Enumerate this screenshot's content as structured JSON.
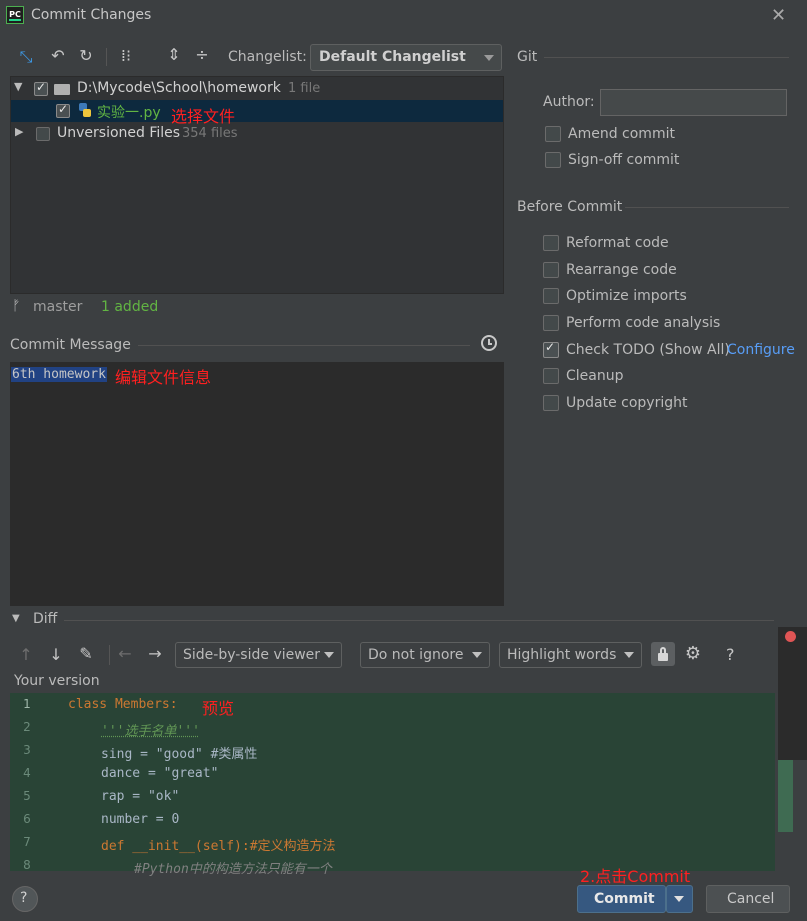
{
  "window": {
    "title": "Commit Changes",
    "close_icon": "close-icon"
  },
  "toolbar": {
    "icons": [
      "move-to-changelist-icon",
      "rollback-icon",
      "refresh-icon",
      "group-by-icon",
      "expand-all-icon",
      "collapse-all-icon"
    ],
    "changelist_label": "Changelist:",
    "changelist_value": "Default Changelist"
  },
  "tree": {
    "root": {
      "path": "D:\\Mycode\\School\\homework",
      "count": "1 file",
      "checked": true
    },
    "file": {
      "name": "实验一.py",
      "checked": true,
      "annotation": "选择文件"
    },
    "unversioned": {
      "label": "Unversioned Files",
      "count": "354 files",
      "checked": false
    }
  },
  "status": {
    "branch": "master",
    "summary": "1 added"
  },
  "commit_message": {
    "label": "Commit Message",
    "text": "6th homework",
    "annotation": "编辑文件信息"
  },
  "git": {
    "section_label": "Git",
    "author_label": "Author:",
    "author_value": "",
    "options": [
      {
        "label": "Amend commit",
        "checked": false
      },
      {
        "label": "Sign-off commit",
        "checked": false
      }
    ]
  },
  "before_commit": {
    "section_label": "Before Commit",
    "options": [
      {
        "label": "Reformat code",
        "checked": false
      },
      {
        "label": "Rearrange code",
        "checked": false
      },
      {
        "label": "Optimize imports",
        "checked": false
      },
      {
        "label": "Perform code analysis",
        "checked": false
      },
      {
        "label": "Check TODO (Show All)",
        "link": "Configure",
        "checked": true
      },
      {
        "label": "Cleanup",
        "checked": false
      },
      {
        "label": "Update copyright",
        "checked": false
      }
    ]
  },
  "diff": {
    "section_label": "Diff",
    "viewer": "Side-by-side viewer",
    "ignore": "Do not ignore",
    "highlight": "Highlight words",
    "help_label": "?",
    "your_version_label": "Your version",
    "preview_annotation": "预览",
    "lines": [
      {
        "no": "1",
        "text": "class Members:"
      },
      {
        "no": "2",
        "text": "'''选手名单'''"
      },
      {
        "no": "3",
        "text": "sing = \"good\" #类属性"
      },
      {
        "no": "4",
        "text": "dance = \"great\""
      },
      {
        "no": "5",
        "text": "rap = \"ok\""
      },
      {
        "no": "6",
        "text": "number = 0"
      },
      {
        "no": "7",
        "text": "def __init__(self):#定义构造方法"
      },
      {
        "no": "8",
        "text": "#Python中的构造方法只能有一个"
      }
    ]
  },
  "footer": {
    "help": "?",
    "commit_annotation": "2.点击Commit",
    "commit_label": "Commit",
    "cancel_label": "Cancel"
  },
  "colors": {
    "background": "#3c3f41",
    "primary_button": "#365880",
    "annotation": "#ff2020",
    "diff_added": "#294436"
  }
}
